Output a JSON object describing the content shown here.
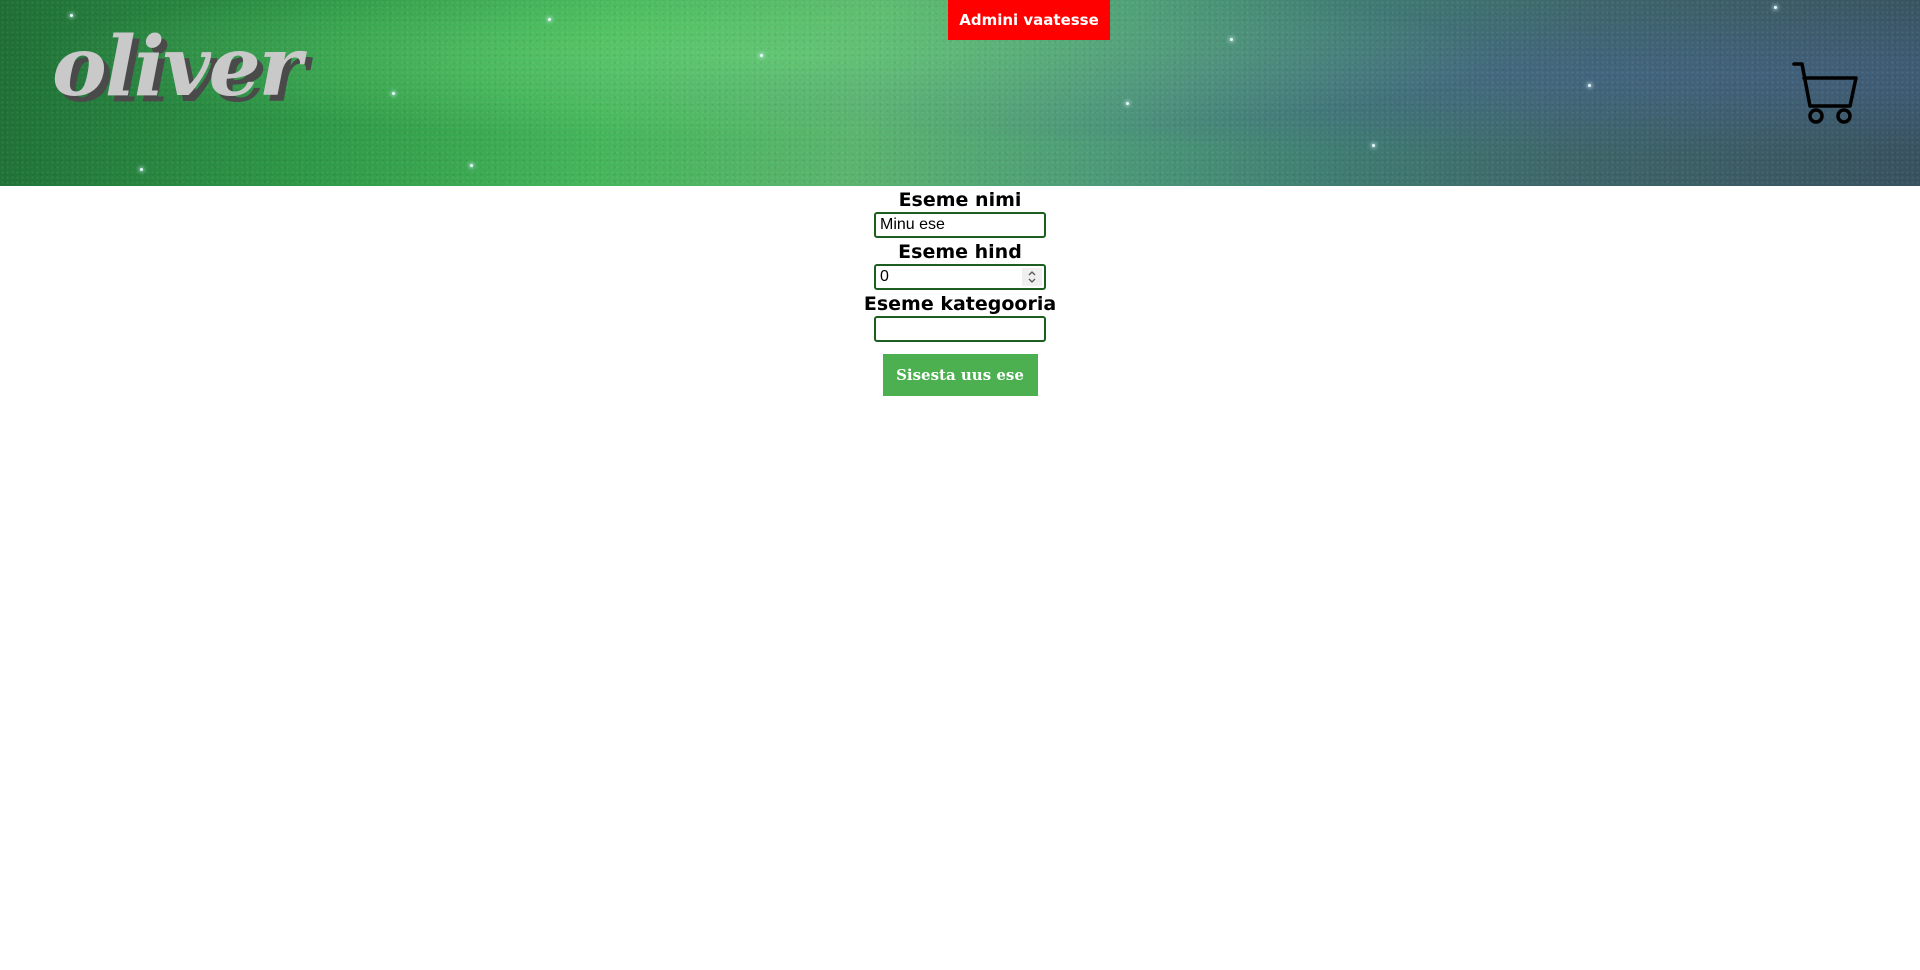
{
  "header": {
    "logo_text": "oliver",
    "admin_button_label": "Admini vaatesse",
    "cart_icon": "shopping-cart-icon"
  },
  "form": {
    "name_label": "Eseme nimi",
    "name_value": "Minu ese",
    "price_label": "Eseme hind",
    "price_value": "0",
    "category_label": "Eseme kategooria",
    "category_value": "",
    "submit_label": "Sisesta uus ese"
  },
  "colors": {
    "admin_button": "#ff0000",
    "submit_button": "#4caf50",
    "input_border": "#1b5e20"
  }
}
